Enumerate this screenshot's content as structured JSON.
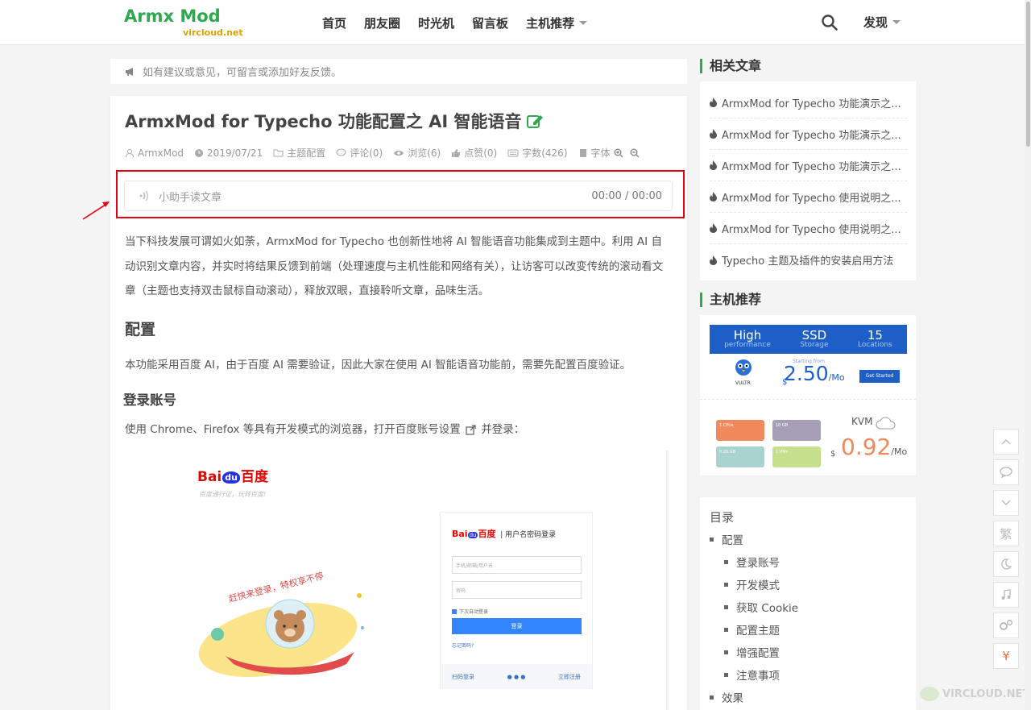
{
  "header": {
    "logo_main": "Armx Mod",
    "logo_sub": "vircloud.net",
    "nav": [
      "首页",
      "朋友圈",
      "时光机",
      "留言板",
      "主机推荐"
    ],
    "discover": "发现"
  },
  "notice": {
    "text": "如有建议或意见，可留言或添加好友反馈。"
  },
  "article": {
    "title": "ArmxMod for Typecho 功能配置之 AI 智能语音",
    "meta": {
      "author": "ArmxMod",
      "date": "2019/07/21",
      "category": "主题配置",
      "comments": "评论(0)",
      "views": "浏览(6)",
      "likes": "点赞(0)",
      "words": "字数(426)",
      "font": "字体"
    },
    "player": {
      "label": "小助手读文章",
      "time": "00:00 / 00:00"
    },
    "p1": "当下科技发展可谓如火如荼，ArmxMod for Typecho 也创新性地将 AI 智能语音功能集成到主题中。利用 AI 自动识别文章内容，并实时将结果反馈到前端（处理速度与主机性能和网络有关），让访客可以改变传统的滚动看文章（主题也支持双击鼠标自动滚动），释放双眼，直接聆听文章，品味生活。",
    "h_config": "配置",
    "p2": "本功能采用百度 AI，由于百度 AI 需要验证，因此大家在使用 AI 智能语音功能前，需要先配置百度验证。",
    "h_login": "登录账号",
    "p3_before": "使用 Chrome、Firefox 等具有开发模式的浏览器，打开百度账号设置",
    "p3_after": "并登录：",
    "screenshot": {
      "logo_bai": "Bai",
      "logo_du": "du",
      "logo_cn": "百度",
      "tagline": "百度通行证，玩转百度!",
      "slogan": "赶快来登录，特权享不停",
      "login_head": "用户名密码登录",
      "field_user": "手机/邮箱/用户名",
      "field_pass": "密码",
      "remember": "下次自动登录",
      "login_btn": "登录",
      "forgot": "忘记密码?",
      "scan": "扫码登录",
      "register": "立即注册"
    }
  },
  "sidebar": {
    "related_title": "相关文章",
    "related": [
      "ArmxMod for Typecho 功能演示之...",
      "ArmxMod for Typecho 功能演示之...",
      "ArmxMod for Typecho 功能演示之...",
      "ArmxMod for Typecho 使用说明之...",
      "ArmxMod for Typecho 使用说明之...",
      "Typecho 主题及插件的安装启用方法"
    ],
    "hosts_title": "主机推荐",
    "vultr": {
      "c1_big": "High",
      "c1_small": "performance",
      "c2_big": "SSD",
      "c2_small": "Storage",
      "c3_big": "15",
      "c3_small": "Locations",
      "from": "Starting from",
      "price": "2.50",
      "per": "/Mo",
      "dollar": "$",
      "btn": "Get Started",
      "name": "VULTR"
    },
    "kvm": {
      "label": "KVM",
      "price": "0.92",
      "per": "/Mo",
      "dollar": "$",
      "card1": "1 CPUs",
      "card2": "10 GB",
      "card3": "0.20 GB",
      "card4": "1 VMs"
    },
    "toc_title": "目录",
    "toc": [
      {
        "label": "配置",
        "level": 1
      },
      {
        "label": "登录账号",
        "level": 2
      },
      {
        "label": "开发模式",
        "level": 2
      },
      {
        "label": "获取 Cookie",
        "level": 2
      },
      {
        "label": "配置主题",
        "level": 2
      },
      {
        "label": "增强配置",
        "level": 2
      },
      {
        "label": "注意事项",
        "level": 2
      },
      {
        "label": "效果",
        "level": 1
      }
    ]
  },
  "toolbar": {
    "traditional": "繁",
    "donate": "¥"
  },
  "watermark": "VIRCLOUD.NET"
}
